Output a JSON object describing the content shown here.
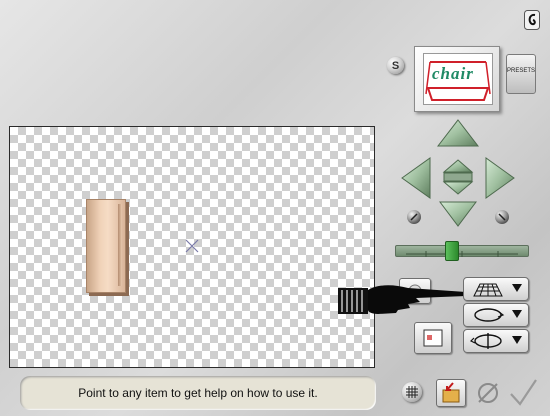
{
  "help": {
    "text": "Point to any item to get help on how to use it."
  },
  "preset": {
    "thumb_text": "chair",
    "button_label": "PRESETS"
  },
  "small_button": {
    "label": "S"
  },
  "icons": {
    "top": "cursor-swirl-icon",
    "up": "arrow-up-icon",
    "down": "arrow-down-icon",
    "left": "arrow-left-icon",
    "right": "arrow-right-icon",
    "center": "center-toggle-icon",
    "rotate_left": "rotate-left-icon",
    "rotate_right": "rotate-right-icon",
    "perspective": "perspective-grid-icon",
    "ellipse": "ellipse-rotate-icon",
    "spin": "spin-icon",
    "view": "view-window-icon",
    "grid": "grid-icon",
    "apply": "apply-icon",
    "cancel": "cancel-icon",
    "ok": "checkmark-icon",
    "hand": "pointing-hand-icon"
  },
  "colors": {
    "accent_green": "#4aa64a",
    "help_bg": "#e6e3d6",
    "object": "#f0d2b8"
  }
}
